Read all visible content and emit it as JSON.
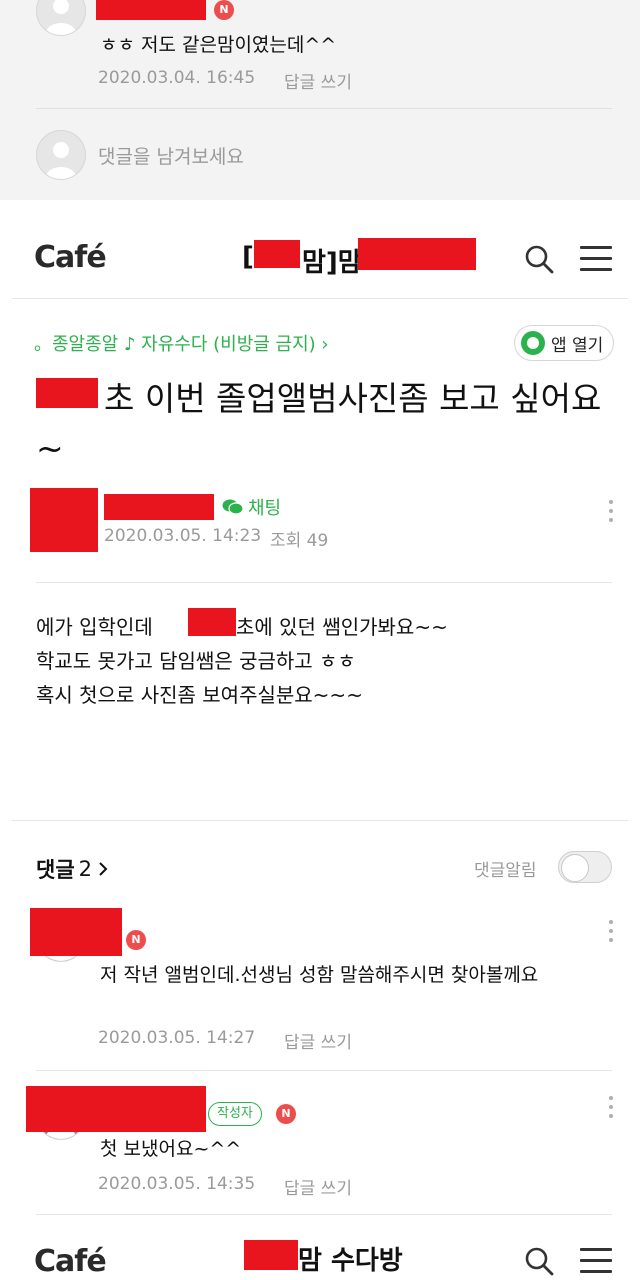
{
  "prev_comment": {
    "text": "ㅎㅎ 저도 같은맘이였는데^^",
    "date": "2020.03.04. 16:45",
    "reply_label": "답글 쓰기",
    "new_badge": "N"
  },
  "comment_input": {
    "placeholder": "댓글을 남겨보세요"
  },
  "header_top": {
    "logo": "Café",
    "title_visible": "[",
    "title_visible_2": "맘]맘"
  },
  "board": {
    "path": "。종알종알 ♪ 자유수다 (비방글 금지) ›",
    "app_open_label": "앱 열기"
  },
  "post": {
    "title_part": "초 이번 졸업앨범사진좀 보고 싶어요~",
    "chat_label": "채팅",
    "date": "2020.03.05. 14:23",
    "views_label": "조회 49",
    "body_lines": [
      "에가 입학인데",
      "초에 있던 쌤인가봐요~~",
      "학교도 못가고 담임쌤은 궁금하고 ㅎㅎ",
      "혹시 첫으로 사진좀 보여주실분요~~~"
    ]
  },
  "comments_section": {
    "label": "댓글",
    "count": "2",
    "alarm_label": "댓글알림",
    "items": [
      {
        "new_badge": "N",
        "text": "저 작년 앨범인데.선생님 성함 말씀해주시면 찾아볼께요",
        "date": "2020.03.05. 14:27",
        "reply_label": "답글 쓰기"
      },
      {
        "writer_badge": "작성자",
        "new_badge": "N",
        "text": "첫 보냈어요~^^",
        "date": "2020.03.05. 14:35",
        "reply_label": "답글 쓰기"
      }
    ]
  },
  "header_bottom": {
    "logo": "Café",
    "title": "맘 수다방"
  }
}
